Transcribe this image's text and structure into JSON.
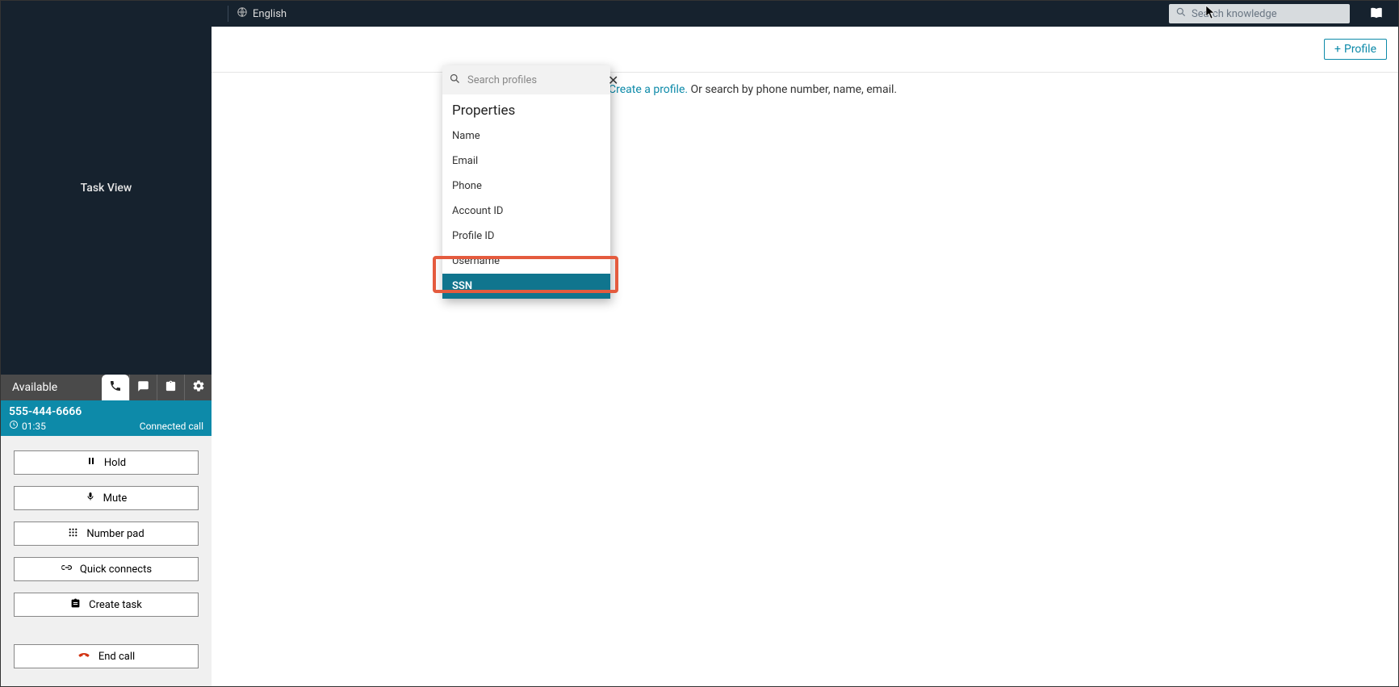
{
  "topbar": {
    "language": "English",
    "search_placeholder": "Search knowledge"
  },
  "sidebar": {
    "task_view_label": "Task View",
    "status": "Available",
    "call": {
      "number": "555-444-6666",
      "timer": "01:35",
      "state": "Connected call"
    },
    "buttons": {
      "hold": "Hold",
      "mute": "Mute",
      "numpad": "Number pad",
      "quick": "Quick connects",
      "create_task": "Create task",
      "end": "End call"
    }
  },
  "content": {
    "profile_button": "Profile",
    "hint_link": "Create a profile.",
    "hint_rest": " Or search by phone number, name, email."
  },
  "search_panel": {
    "placeholder": "Search profiles",
    "title": "Properties",
    "items": [
      {
        "label": "Name"
      },
      {
        "label": "Email"
      },
      {
        "label": "Phone"
      },
      {
        "label": "Account ID"
      },
      {
        "label": "Profile ID"
      },
      {
        "label": "Username"
      },
      {
        "label": "SSN"
      }
    ]
  }
}
